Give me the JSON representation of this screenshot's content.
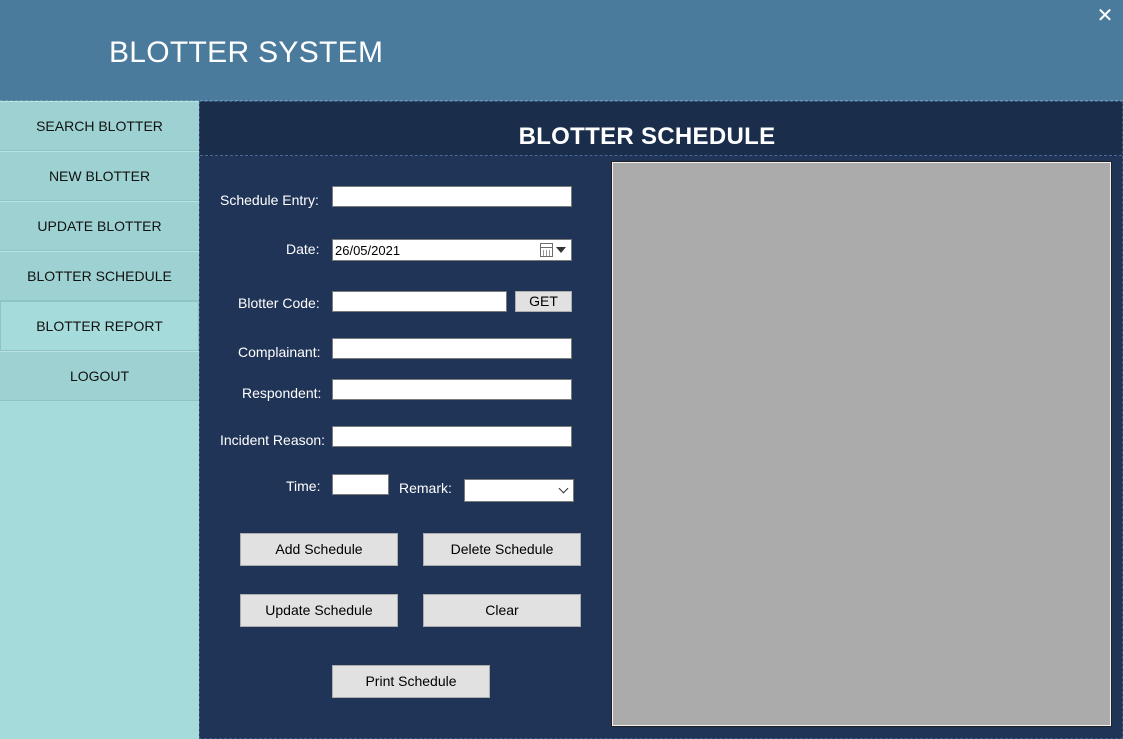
{
  "window": {
    "title": "BLOTTER SYSTEM",
    "close_label": "✕"
  },
  "sidebar": {
    "items": [
      {
        "label": "SEARCH BLOTTER"
      },
      {
        "label": "NEW BLOTTER"
      },
      {
        "label": "UPDATE BLOTTER"
      },
      {
        "label": "BLOTTER SCHEDULE"
      },
      {
        "label": "BLOTTER REPORT"
      },
      {
        "label": "LOGOUT"
      }
    ]
  },
  "main": {
    "title": "BLOTTER SCHEDULE",
    "form": {
      "schedule_entry": {
        "label": "Schedule Entry:",
        "value": ""
      },
      "date": {
        "label": "Date:",
        "value": "26/05/2021"
      },
      "blotter_code": {
        "label": "Blotter Code:",
        "value": "",
        "get_label": "GET"
      },
      "complainant": {
        "label": "Complainant:",
        "value": ""
      },
      "respondent": {
        "label": "Respondent:",
        "value": ""
      },
      "incident_reason": {
        "label": "Incident Reason:",
        "value": ""
      },
      "time": {
        "label": "Time:",
        "value": ""
      },
      "remark": {
        "label": "Remark:",
        "value": ""
      }
    },
    "buttons": {
      "add": "Add Schedule",
      "delete": "Delete Schedule",
      "update": "Update Schedule",
      "clear": "Clear",
      "print": "Print Schedule"
    }
  },
  "colors": {
    "titlebar": "#4a7a9c",
    "sidebar": "#a6dbdb",
    "main_bg": "#203457",
    "grid_bg": "#ababab"
  },
  "icons": {
    "close": "close-icon",
    "calendar": "calendar-icon",
    "dropdown": "chevron-down-icon"
  }
}
